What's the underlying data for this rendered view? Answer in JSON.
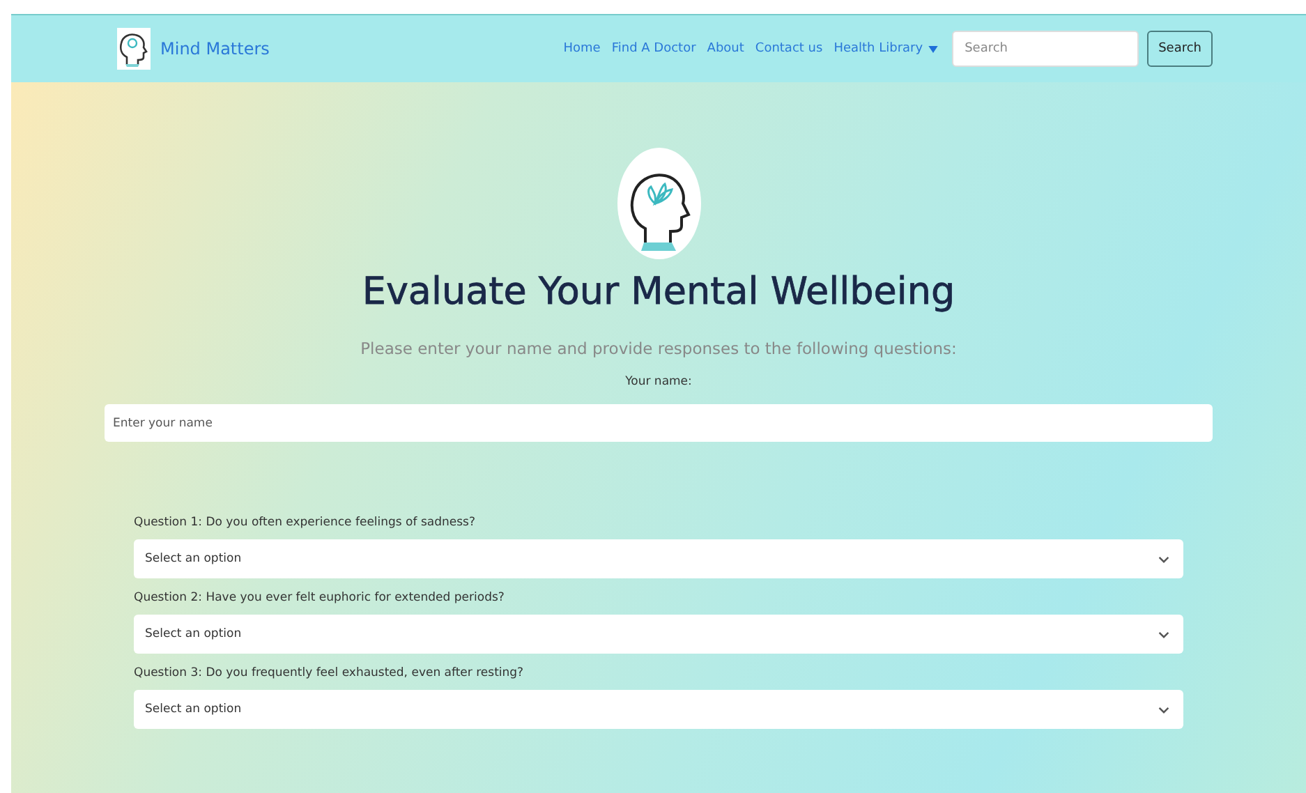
{
  "navbar": {
    "brand": "Mind Matters",
    "links": [
      {
        "label": "Home",
        "kind": "link"
      },
      {
        "label": "Find A Doctor",
        "kind": "link"
      },
      {
        "label": "About",
        "kind": "link"
      },
      {
        "label": "Contact us",
        "kind": "link"
      },
      {
        "label": "Health Library",
        "kind": "dropdown"
      }
    ],
    "search": {
      "placeholder": "Search",
      "button": "Search"
    }
  },
  "title": "Evaluate Your Mental Wellbeing",
  "subtitle": "Please enter your name and provide responses to the following questions:",
  "name_field": {
    "label": "Your name:",
    "placeholder": "Enter your name"
  },
  "questions": [
    {
      "label": "Question 1: Do you often experience feelings of sadness?",
      "placeholder": "Select an option"
    },
    {
      "label": "Question 2: Have you ever felt euphoric for extended periods?",
      "placeholder": "Select an option"
    },
    {
      "label": "Question 3: Do you frequently feel exhausted, even after resting?",
      "placeholder": "Select an option"
    }
  ]
}
